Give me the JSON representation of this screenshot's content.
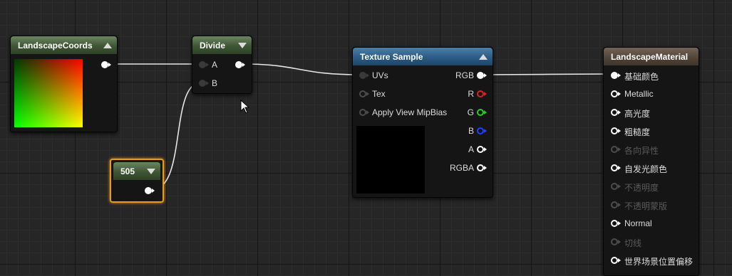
{
  "nodes": {
    "landscape_coords": {
      "title": "LandscapeCoords",
      "header_color": "#3f5635"
    },
    "divide": {
      "title": "Divide",
      "input_a": "A",
      "input_b": "B"
    },
    "constant": {
      "title": "505",
      "selected_border": "#e89a1c"
    },
    "texture_sample": {
      "title": "Texture Sample",
      "header_color": "#2b5b86",
      "inputs": [
        "UVs",
        "Tex",
        "Apply View MipBias"
      ],
      "outputs": [
        "RGB",
        "R",
        "G",
        "B",
        "A",
        "RGBA"
      ]
    },
    "landscape_material": {
      "title": "LandscapeMaterial",
      "header_color": "#4f4338",
      "inputs": [
        {
          "label": "基础颜色",
          "enabled": true
        },
        {
          "label": "Metallic",
          "enabled": true
        },
        {
          "label": "高光度",
          "enabled": true
        },
        {
          "label": "粗糙度",
          "enabled": true
        },
        {
          "label": "各向异性",
          "enabled": false
        },
        {
          "label": "自发光颜色",
          "enabled": true
        },
        {
          "label": "不透明度",
          "enabled": false
        },
        {
          "label": "不透明蒙版",
          "enabled": false
        },
        {
          "label": "Normal",
          "enabled": true
        },
        {
          "label": "切线",
          "enabled": false
        },
        {
          "label": "世界场景位置偏移",
          "enabled": true
        }
      ]
    }
  },
  "colors": {
    "pin_r": "#e02020",
    "pin_g": "#20d020",
    "pin_b": "#2040ff",
    "wire": "#e6e6e6",
    "selection": "#e89a1c"
  },
  "icons": [
    "collapse-arrow-up-icon",
    "collapse-arrow-down-icon",
    "mouse-cursor-icon"
  ]
}
